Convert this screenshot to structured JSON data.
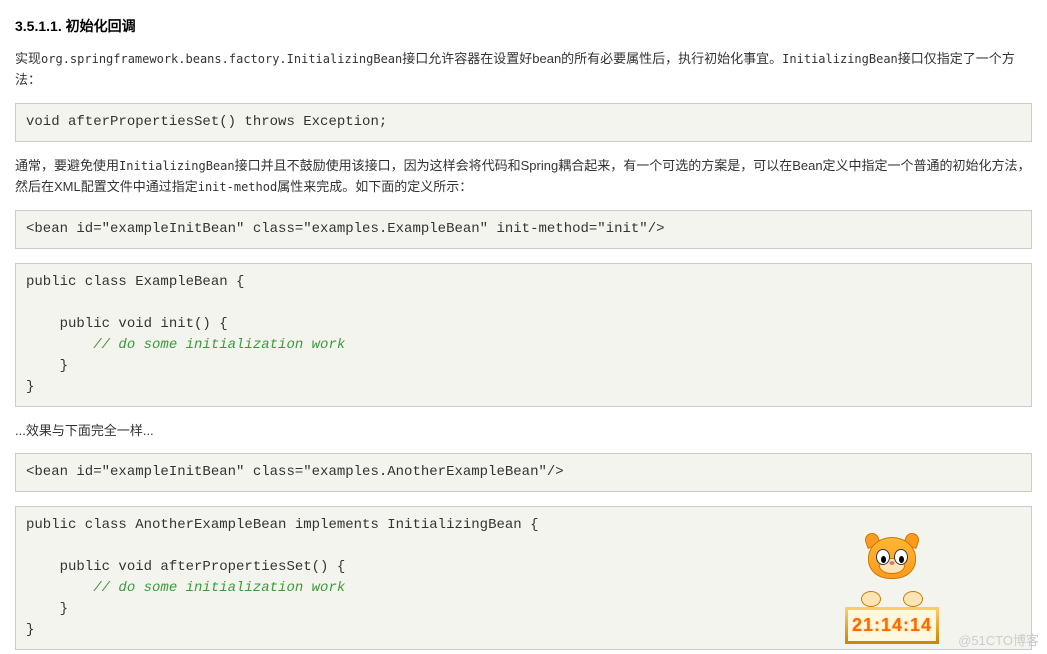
{
  "heading": "3.5.1.1. 初始化回调",
  "para1_pre": "实现",
  "para1_code": "org.springframework.beans.factory.InitializingBean",
  "para1_mid": "接口允许容器在设置好bean的所有必要属性后，执行初始化事宜。",
  "para1_code2": "InitializingBean",
  "para1_post": "接口仅指定了一个方法：",
  "code1": "void afterPropertiesSet() throws Exception;",
  "para2_pre": "通常，要避免使用",
  "para2_c1": "InitializingBean",
  "para2_mid1": "接口并且不鼓励使用该接口，因为这样会将代码和Spring耦合起来，有一个可选的方案是，可以在Bean定义中指定一个普通的初始化方法，然后在XML配置文件中通过指定",
  "para2_c2": "init-method",
  "para2_mid2": "属性来完成。如下面的定义所示：",
  "code2": "<bean id=\"exampleInitBean\" class=\"examples.ExampleBean\" init-method=\"init\"/>",
  "code3_line1": "public class ExampleBean {",
  "code3_line2": "",
  "code3_line3": "    public void init() {",
  "code3_comment": "        // do some initialization work",
  "code3_line5": "    }",
  "code3_line6": "}",
  "para3": "...效果与下面完全一样...",
  "code4": "<bean id=\"exampleInitBean\" class=\"examples.AnotherExampleBean\"/>",
  "code5_line1": "public class AnotherExampleBean implements InitializingBean {",
  "code5_line2": "",
  "code5_line3": "    public void afterPropertiesSet() {",
  "code5_comment": "        // do some initialization work",
  "code5_line5": "    }",
  "code5_line6": "}",
  "clock_time": "21:14:14",
  "watermark": "@51CTO博客"
}
